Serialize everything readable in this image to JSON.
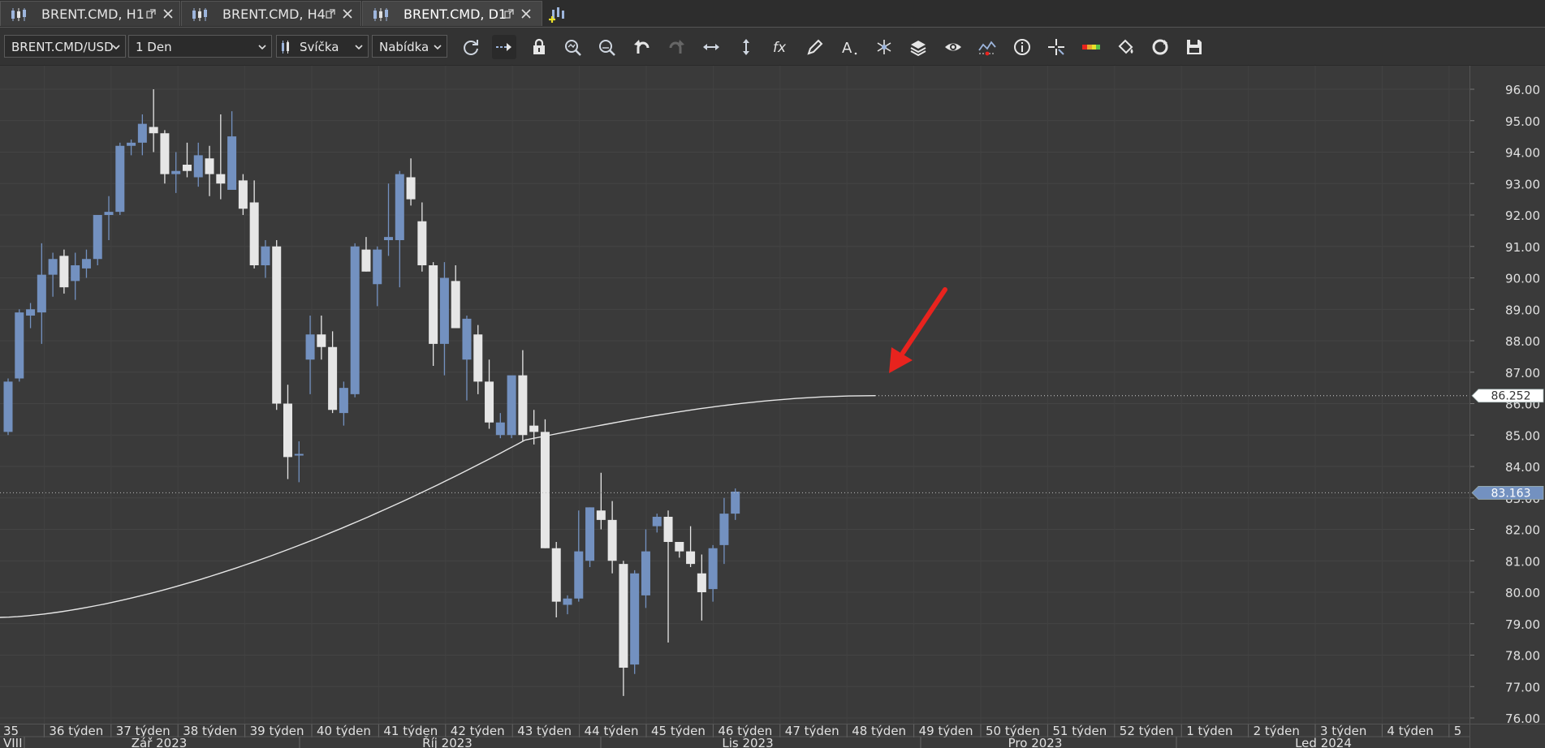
{
  "tabs": [
    {
      "label": "BRENT.CMD, H1",
      "active": false
    },
    {
      "label": "BRENT.CMD, H4",
      "active": false
    },
    {
      "label": "BRENT.CMD, D1",
      "active": true
    }
  ],
  "toolbar": {
    "instrument": "BRENT.CMD/USD",
    "period": "1 Den",
    "chart_type": "Svíčka",
    "price_side": "Nabídka",
    "tools": [
      "refresh-icon",
      "shift-chart-icon",
      "lock-icon",
      "zoom-in-icon",
      "zoom-out-icon",
      "undo-icon",
      "redo-icon",
      "fit-horizontal-icon",
      "fit-vertical-icon",
      "indicator-fx-icon",
      "pencil-icon",
      "text-tool-icon",
      "pattern-icon",
      "layers-icon",
      "eye-icon",
      "trend-signals-icon",
      "info-icon",
      "crosshair-icon",
      "color-theme-icon",
      "paint-bucket-icon",
      "sync-icon",
      "save-icon"
    ]
  },
  "colors": {
    "background": "#3a3a3a",
    "bull_candle": "#7391c0",
    "bear_candle": "#e6e6e6",
    "ma_line": "#e6e6e6",
    "last_price_box": "#7391c0",
    "arrow": "#e8231e"
  },
  "chart_data": {
    "type": "candlestick",
    "instrument": "BRENT.CMD/USD",
    "timeframe": "D1",
    "y_axis": {
      "ticks": [
        "96.00",
        "95.00",
        "94.00",
        "93.00",
        "92.00",
        "91.00",
        "90.00",
        "89.00",
        "88.00",
        "87.00",
        "86.00",
        "85.00",
        "84.00",
        "83.00",
        "82.00",
        "81.00",
        "80.00",
        "79.00",
        "78.00",
        "77.00",
        "76.00"
      ],
      "min": 75.7,
      "max": 96.8
    },
    "x_axis_weeks": [
      "35",
      "36 týden",
      "37 týden",
      "38 týden",
      "39 týden",
      "40 týden",
      "41 týden",
      "42 týden",
      "43 týden",
      "44 týden",
      "45 týden",
      "46 týden",
      "47 týden",
      "48 týden",
      "49 týden",
      "50 týden",
      "51 týden",
      "52 týden",
      "1 týden",
      "2 týden",
      "3 týden",
      "4 týden",
      "5"
    ],
    "x_axis_months": [
      "VIII",
      "Zář 2023",
      "Říj 2023",
      "Lis 2023",
      "Pro 2023",
      "Led 2024"
    ],
    "candles": [
      {
        "o": 85.1,
        "h": 86.8,
        "l": 85.0,
        "c": 86.7
      },
      {
        "o": 86.8,
        "h": 89.0,
        "l": 86.7,
        "c": 88.9
      },
      {
        "o": 88.8,
        "h": 89.2,
        "l": 88.4,
        "c": 89.0
      },
      {
        "o": 88.9,
        "h": 91.1,
        "l": 87.9,
        "c": 90.1
      },
      {
        "o": 90.1,
        "h": 90.8,
        "l": 89.4,
        "c": 90.6
      },
      {
        "o": 90.7,
        "h": 90.9,
        "l": 89.5,
        "c": 89.7
      },
      {
        "o": 89.9,
        "h": 90.8,
        "l": 89.3,
        "c": 90.4
      },
      {
        "o": 90.3,
        "h": 90.9,
        "l": 90.0,
        "c": 90.6
      },
      {
        "o": 90.6,
        "h": 91.4,
        "l": 90.4,
        "c": 92.0
      },
      {
        "o": 92.0,
        "h": 92.6,
        "l": 91.2,
        "c": 92.1
      },
      {
        "o": 92.1,
        "h": 94.3,
        "l": 92.0,
        "c": 94.2
      },
      {
        "o": 94.2,
        "h": 94.4,
        "l": 93.9,
        "c": 94.3
      },
      {
        "o": 94.3,
        "h": 95.2,
        "l": 93.9,
        "c": 94.9
      },
      {
        "o": 94.8,
        "h": 96.0,
        "l": 94.0,
        "c": 94.6
      },
      {
        "o": 94.6,
        "h": 94.7,
        "l": 93.0,
        "c": 93.3
      },
      {
        "o": 93.3,
        "h": 94.0,
        "l": 92.7,
        "c": 93.4
      },
      {
        "o": 93.6,
        "h": 94.3,
        "l": 93.2,
        "c": 93.4
      },
      {
        "o": 93.2,
        "h": 94.3,
        "l": 92.9,
        "c": 93.9
      },
      {
        "o": 93.8,
        "h": 94.2,
        "l": 92.6,
        "c": 93.3
      },
      {
        "o": 93.3,
        "h": 95.2,
        "l": 92.5,
        "c": 93.0
      },
      {
        "o": 92.8,
        "h": 95.3,
        "l": 92.8,
        "c": 94.5
      },
      {
        "o": 93.1,
        "h": 93.3,
        "l": 92.0,
        "c": 92.2
      },
      {
        "o": 92.4,
        "h": 93.1,
        "l": 90.3,
        "c": 90.4
      },
      {
        "o": 90.4,
        "h": 91.2,
        "l": 90.0,
        "c": 91.0
      },
      {
        "o": 91.0,
        "h": 91.2,
        "l": 85.8,
        "c": 86.0
      },
      {
        "o": 86.0,
        "h": 86.6,
        "l": 83.6,
        "c": 84.3
      },
      {
        "o": 84.4,
        "h": 84.8,
        "l": 83.5,
        "c": 84.4
      },
      {
        "o": 87.4,
        "h": 88.8,
        "l": 86.3,
        "c": 88.2
      },
      {
        "o": 88.2,
        "h": 88.8,
        "l": 87.4,
        "c": 87.8
      },
      {
        "o": 87.8,
        "h": 88.3,
        "l": 85.7,
        "c": 85.8
      },
      {
        "o": 85.7,
        "h": 86.7,
        "l": 85.3,
        "c": 86.5
      },
      {
        "o": 86.3,
        "h": 91.1,
        "l": 86.2,
        "c": 91.0
      },
      {
        "o": 90.9,
        "h": 91.3,
        "l": 90.2,
        "c": 90.2
      },
      {
        "o": 89.8,
        "h": 91.0,
        "l": 89.1,
        "c": 90.9
      },
      {
        "o": 91.2,
        "h": 93.0,
        "l": 90.7,
        "c": 91.3
      },
      {
        "o": 91.2,
        "h": 93.4,
        "l": 89.7,
        "c": 93.3
      },
      {
        "o": 93.2,
        "h": 93.8,
        "l": 92.3,
        "c": 92.5
      },
      {
        "o": 91.8,
        "h": 92.4,
        "l": 90.2,
        "c": 90.4
      },
      {
        "o": 90.4,
        "h": 90.5,
        "l": 87.2,
        "c": 87.9
      },
      {
        "o": 87.9,
        "h": 90.5,
        "l": 86.9,
        "c": 90.0
      },
      {
        "o": 89.9,
        "h": 90.4,
        "l": 88.4,
        "c": 88.4
      },
      {
        "o": 87.4,
        "h": 88.8,
        "l": 86.1,
        "c": 88.7
      },
      {
        "o": 88.2,
        "h": 88.5,
        "l": 86.3,
        "c": 86.7
      },
      {
        "o": 86.7,
        "h": 87.4,
        "l": 85.2,
        "c": 85.4
      },
      {
        "o": 85.0,
        "h": 85.7,
        "l": 84.9,
        "c": 85.4
      },
      {
        "o": 85.0,
        "h": 86.8,
        "l": 84.9,
        "c": 86.9
      },
      {
        "o": 86.9,
        "h": 87.7,
        "l": 84.8,
        "c": 85.0
      },
      {
        "o": 85.3,
        "h": 85.8,
        "l": 84.7,
        "c": 85.1
      },
      {
        "o": 85.1,
        "h": 85.5,
        "l": 81.4,
        "c": 81.4
      },
      {
        "o": 81.4,
        "h": 81.6,
        "l": 79.2,
        "c": 79.7
      },
      {
        "o": 79.6,
        "h": 79.9,
        "l": 79.3,
        "c": 79.8
      },
      {
        "o": 79.8,
        "h": 82.6,
        "l": 79.7,
        "c": 81.3
      },
      {
        "o": 81.0,
        "h": 82.7,
        "l": 80.8,
        "c": 82.7
      },
      {
        "o": 82.6,
        "h": 83.8,
        "l": 82.0,
        "c": 82.3
      },
      {
        "o": 82.3,
        "h": 82.9,
        "l": 80.6,
        "c": 81.0
      },
      {
        "o": 80.9,
        "h": 81.0,
        "l": 76.7,
        "c": 77.6
      },
      {
        "o": 77.7,
        "h": 80.7,
        "l": 77.4,
        "c": 80.6
      },
      {
        "o": 79.9,
        "h": 82.0,
        "l": 79.5,
        "c": 81.3
      },
      {
        "o": 82.1,
        "h": 82.5,
        "l": 81.9,
        "c": 82.4
      },
      {
        "o": 82.4,
        "h": 82.6,
        "l": 78.4,
        "c": 81.6
      },
      {
        "o": 81.6,
        "h": 81.6,
        "l": 81.1,
        "c": 81.3
      },
      {
        "o": 81.3,
        "h": 82.1,
        "l": 80.8,
        "c": 80.9
      },
      {
        "o": 80.6,
        "h": 81.2,
        "l": 79.1,
        "c": 80.0
      },
      {
        "o": 80.1,
        "h": 81.5,
        "l": 79.7,
        "c": 81.4
      },
      {
        "o": 81.5,
        "h": 83.0,
        "l": 80.9,
        "c": 82.5
      },
      {
        "o": 82.5,
        "h": 83.3,
        "l": 82.3,
        "c": 83.2
      }
    ],
    "ma_line": {
      "start": 79.2,
      "end": 86.252,
      "label": "86.252"
    },
    "last_price": {
      "value": 83.163,
      "label": "83.163"
    },
    "annotation": "red-arrow-pointing-to-ma-end"
  }
}
